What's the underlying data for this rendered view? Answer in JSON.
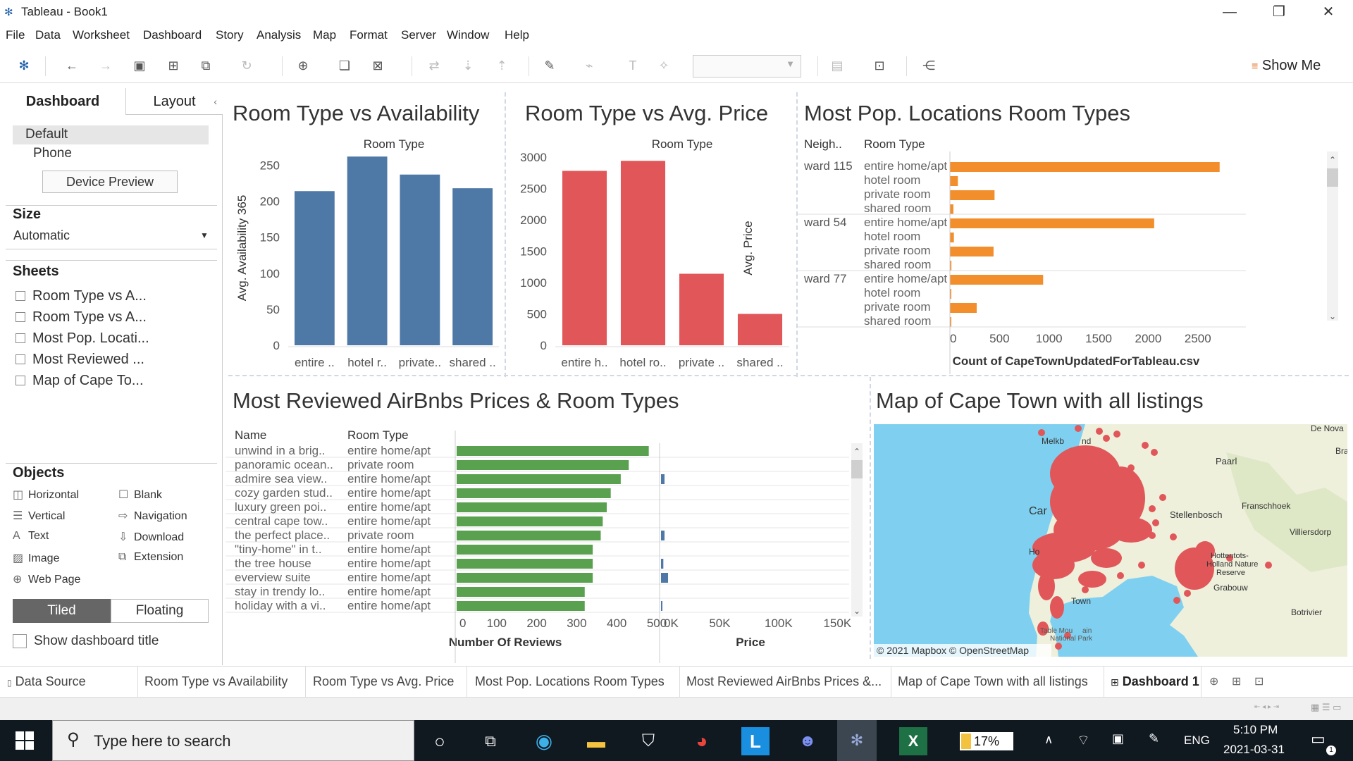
{
  "window": {
    "title": "Tableau - Book1"
  },
  "menu": [
    "File",
    "Data",
    "Worksheet",
    "Dashboard",
    "Story",
    "Analysis",
    "Map",
    "Format",
    "Server",
    "Window",
    "Help"
  ],
  "toolbar": {
    "show_me": "Show Me"
  },
  "sidebar": {
    "tab_dashboard": "Dashboard",
    "tab_layout": "Layout",
    "device_default": "Default",
    "device_phone": "Phone",
    "device_preview": "Device Preview",
    "size_heading": "Size",
    "size_value": "Automatic",
    "sheets_heading": "Sheets",
    "sheets": [
      "Room Type vs A...",
      "Room Type vs A...",
      "Most Pop. Locati...",
      "Most Reviewed ...",
      "Map of Cape To..."
    ],
    "objects_heading": "Objects",
    "objects": [
      "Horizontal",
      "Blank",
      "Vertical",
      "Navigation",
      "Text",
      "Download",
      "Image",
      "Extension",
      "Web Page"
    ],
    "tiled": "Tiled",
    "floating": "Floating",
    "show_title": "Show dashboard title"
  },
  "colors": {
    "blue": "#4e79a7",
    "red": "#e15759",
    "orange": "#f28e2b",
    "green": "#59a14f",
    "water": "#7fd0f0",
    "land": "#eef0dc"
  },
  "chart_data": [
    {
      "type": "bar",
      "title": "Room Type vs Availability",
      "header": "Room Type",
      "ylabel": "Avg. Availability 365",
      "categories": [
        "entire ..",
        "hotel r..",
        "private..",
        "shared .."
      ],
      "values": [
        214,
        262,
        237,
        218
      ],
      "ylim": [
        0,
        270
      ],
      "yticks": [
        0,
        50,
        100,
        150,
        200,
        250
      ]
    },
    {
      "type": "bar",
      "title": "Room Type vs Avg. Price",
      "header": "Room Type",
      "ylabel": "Avg. Price",
      "categories": [
        "entire h..",
        "hotel ro..",
        "private ..",
        "shared .."
      ],
      "values": [
        2780,
        2940,
        1140,
        500
      ],
      "ylim": [
        0,
        3100
      ],
      "yticks": [
        0,
        500,
        1000,
        1500,
        2000,
        2500,
        3000
      ]
    },
    {
      "type": "bar",
      "title": "Most Pop. Locations Room Types",
      "col1": "Neigh..",
      "col2": "Room Type",
      "xlabel": "Count of CapeTownUpdatedForTableau.csv",
      "xticks": [
        0,
        500,
        1000,
        1500,
        2000,
        2500
      ],
      "xlim": [
        0,
        2800
      ],
      "groups": [
        {
          "name": "ward 115",
          "rows": [
            {
              "type": "entire home/apt",
              "value": 2720
            },
            {
              "type": "hotel room",
              "value": 80
            },
            {
              "type": "private room",
              "value": 450
            },
            {
              "type": "shared room",
              "value": 35
            }
          ]
        },
        {
          "name": "ward 54",
          "rows": [
            {
              "type": "entire home/apt",
              "value": 2060
            },
            {
              "type": "hotel room",
              "value": 40
            },
            {
              "type": "private room",
              "value": 440
            },
            {
              "type": "shared room",
              "value": 15
            }
          ]
        },
        {
          "name": "ward 77",
          "rows": [
            {
              "type": "entire home/apt",
              "value": 940
            },
            {
              "type": "hotel room",
              "value": 10
            },
            {
              "type": "private room",
              "value": 270
            },
            {
              "type": "shared room",
              "value": 10
            }
          ]
        }
      ]
    },
    {
      "type": "bar",
      "title": "Most Reviewed AirBnbs Prices & Room Types",
      "col1": "Name",
      "col2": "Room Type",
      "xlabel1": "Number Of Reviews",
      "xlabel2": "Price",
      "xticks1": [
        0,
        100,
        200,
        300,
        400,
        500
      ],
      "xlim1": [
        0,
        500
      ],
      "xticks2": [
        "0K",
        "50K",
        "100K",
        "150K"
      ],
      "xlim2": [
        0,
        160000
      ],
      "rows": [
        {
          "name": "unwind in a brig..",
          "type": "entire home/apt",
          "reviews": 480,
          "price": 0
        },
        {
          "name": "panoramic ocean..",
          "type": "private room",
          "reviews": 430,
          "price": 0
        },
        {
          "name": "admire sea view..",
          "type": "entire home/apt",
          "reviews": 410,
          "price": 3000
        },
        {
          "name": "cozy garden stud..",
          "type": "entire home/apt",
          "reviews": 385,
          "price": 0
        },
        {
          "name": "luxury green poi..",
          "type": "entire home/apt",
          "reviews": 375,
          "price": 0
        },
        {
          "name": "central cape tow..",
          "type": "entire home/apt",
          "reviews": 365,
          "price": 0
        },
        {
          "name": "the perfect place..",
          "type": "private room",
          "reviews": 360,
          "price": 3000
        },
        {
          "name": "\"tiny-home\" in t..",
          "type": "entire home/apt",
          "reviews": 340,
          "price": 0
        },
        {
          "name": "the tree house",
          "type": "entire home/apt",
          "reviews": 340,
          "price": 2000
        },
        {
          "name": "everview suite",
          "type": "entire home/apt",
          "reviews": 340,
          "price": 6000
        },
        {
          "name": "stay in trendy lo..",
          "type": "entire home/apt",
          "reviews": 320,
          "price": 0
        },
        {
          "name": "holiday with a vi..",
          "type": "entire home/apt",
          "reviews": 320,
          "price": 1000
        }
      ]
    }
  ],
  "map": {
    "title": "Map of Cape Town with all listings",
    "attribution": "© 2021 Mapbox © OpenStreetMap",
    "places": [
      "De Nova",
      "Melkb",
      "nd",
      "Paarl",
      "Bra",
      "Franschhoek",
      "Car",
      "Stellenbosch",
      "Villiersdorp",
      "Ho",
      "Hottentots-",
      "Holland Nature",
      "Reserve",
      "Grabouw",
      "Town",
      "Botrivier",
      "Table Mou",
      "ain",
      "National Park"
    ]
  },
  "tabs": {
    "data_source": "Data Source",
    "t1": "Room Type vs Availability",
    "t2": "Room Type vs Avg. Price",
    "t3": "Most Pop. Locations Room Types",
    "t4": "Most Reviewed AirBnbs Prices &...",
    "t5": "Map of Cape Town with all listings",
    "dashboard": "Dashboard 1"
  },
  "taskbar": {
    "search_placeholder": "Type here to search",
    "battery": "17%",
    "lang": "ENG",
    "time": "5:10 PM",
    "date": "2021-03-31"
  }
}
